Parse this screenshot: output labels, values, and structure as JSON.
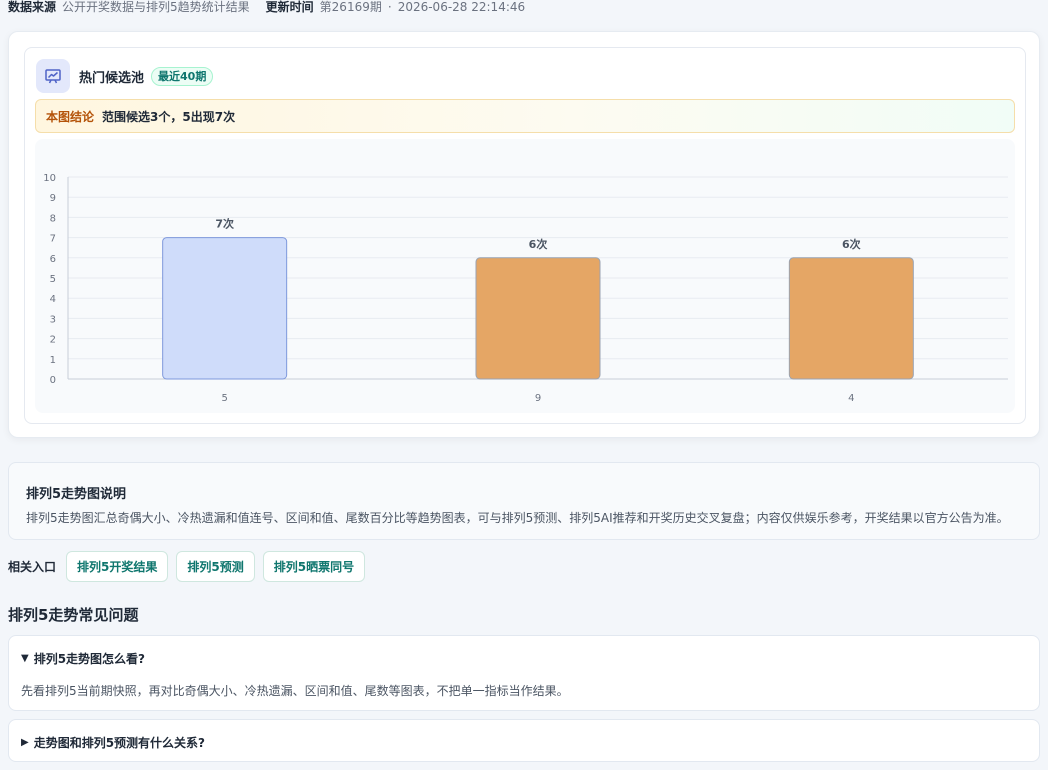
{
  "meta": {
    "source_label": "数据来源",
    "source_value": "公开开奖数据与排列5趋势统计结果",
    "update_label": "更新时间",
    "update_issue": "第26169期",
    "separator": "·",
    "update_time": "2026-06-28 22:14:46"
  },
  "panel": {
    "icon": "presentation-chart-icon",
    "title": "热门候选池",
    "badge": "最近40期",
    "conclusion_tag": "本图结论",
    "conclusion_text": "范围候选3个，5出现7次"
  },
  "chart_data": {
    "type": "bar",
    "categories": [
      "5",
      "9",
      "4"
    ],
    "values": [
      7,
      6,
      6
    ],
    "value_labels": [
      "7次",
      "6次",
      "6次"
    ],
    "bar_colors": [
      "#cfdcfa",
      "#e5a665",
      "#e5a665"
    ],
    "bar_stroke_colors": [
      "#7e98dc",
      "#9aa3b2",
      "#9aa3b2"
    ],
    "ylim": [
      0,
      10
    ],
    "y_ticks": [
      "0",
      "1",
      "2",
      "3",
      "4",
      "5",
      "6",
      "7",
      "8",
      "9",
      "10"
    ],
    "grid": true,
    "legend": "none",
    "title": "",
    "xlabel": "",
    "ylabel": ""
  },
  "explain": {
    "title": "排列5走势图说明",
    "text": "排列5走势图汇总奇偶大小、冷热遗漏和值连号、区间和值、尾数百分比等趋势图表，可与排列5预测、排列5AI推荐和开奖历史交叉复盘；内容仅供娱乐参考，开奖结果以官方公告为准。"
  },
  "related": {
    "label": "相关入口",
    "links": [
      "排列5开奖结果",
      "排列5预测",
      "排列5晒票同号"
    ]
  },
  "faq": {
    "heading": "排列5走势常见问题",
    "items": [
      {
        "arrow": "▼",
        "question": "排列5走势图怎么看?",
        "answer": "先看排列5当前期快照，再对比奇偶大小、冷热遗漏、区间和值、尾数等图表，不把单一指标当作结果。",
        "expanded": true
      },
      {
        "arrow": "▶",
        "question": "走势图和排列5预测有什么关系?",
        "expanded": false
      }
    ]
  },
  "colors": {
    "accent_green": "#0f766e",
    "warn_brown": "#b45309",
    "page_bg": "#f3f6fa"
  }
}
